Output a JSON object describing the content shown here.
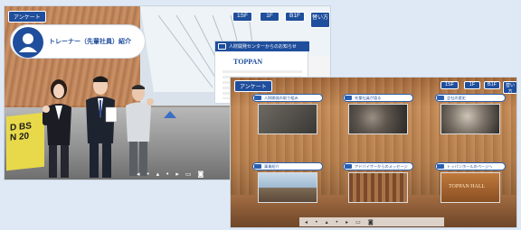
{
  "lobby": {
    "survey_button": "アンケート",
    "floors": [
      "1SF",
      "1F",
      "B1F",
      "替い方"
    ],
    "trainer_label": "トレーナー（先輩社員）紹介",
    "notice_title": "人財開発センターからのお知らせ",
    "logo_text": "TOPPAN",
    "poster_text": "D BS\nN 20"
  },
  "theater": {
    "survey_button": "アンケート",
    "floors": [
      "1SF",
      "1F",
      "B1F",
      "替い方"
    ],
    "tiles": [
      {
        "label": "人財開発の取り組み"
      },
      {
        "label": "先輩社員が語る"
      },
      {
        "label": "会社の歴史"
      },
      {
        "label": "事業紹介"
      },
      {
        "label": "アドバイザーからのメッセージ"
      },
      {
        "label": "トッパンホールのページへ"
      }
    ],
    "hall_text": "TOPPAN HALL"
  },
  "colors": {
    "brand_blue": "#1f4e9c",
    "page_bg": "#dfe9f6"
  }
}
